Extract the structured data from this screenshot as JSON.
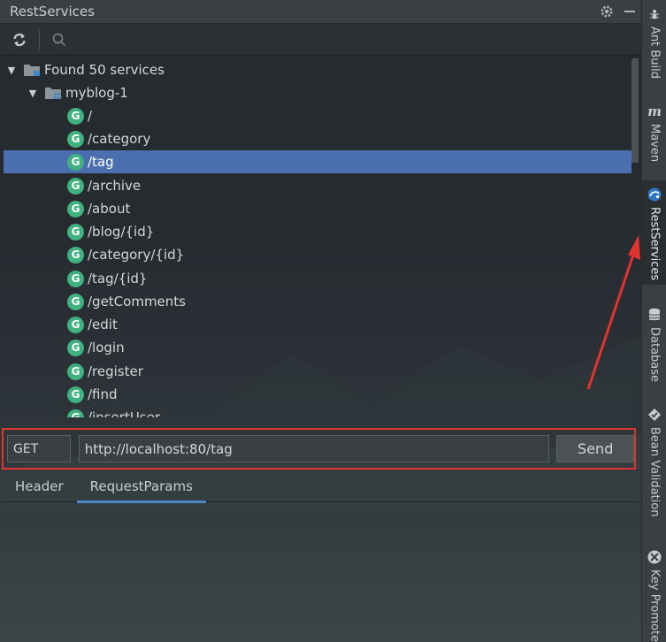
{
  "window": {
    "title": "RestServices"
  },
  "toolbar": {
    "refresh_icon": "refresh-icon",
    "search_icon": "search-icon"
  },
  "tree": {
    "root_label": "Found 50 services",
    "module_label": "myblog-1",
    "method_badge": "G",
    "services": [
      "/",
      "/category",
      "/tag",
      "/archive",
      "/about",
      "/blog/{id}",
      "/category/{id}",
      "/tag/{id}",
      "/getComments",
      "/edit",
      "/login",
      "/register",
      "/find",
      "/insertUser"
    ],
    "selected_service": "/tag"
  },
  "request": {
    "method": "GET",
    "url": "http://localhost:80/tag",
    "send_label": "Send"
  },
  "tabs": [
    {
      "label": "Header",
      "active": false
    },
    {
      "label": "RequestParams",
      "active": true
    }
  ],
  "side_panels": [
    {
      "label": "Ant Build",
      "icon": "ant-icon",
      "active": false
    },
    {
      "label": "Maven",
      "icon": "maven-icon",
      "active": false
    },
    {
      "label": "RestServices",
      "icon": "rest-services-icon",
      "active": true
    },
    {
      "label": "Database",
      "icon": "database-icon",
      "active": false
    },
    {
      "label": "Bean Validation",
      "icon": "bean-validation-icon",
      "active": false
    },
    {
      "label": "Key Promoter",
      "icon": "key-promoter-icon",
      "active": false
    }
  ],
  "colors": {
    "selection": "#4b6eaf",
    "method_badge": "#3fb27f",
    "highlight_annotation": "#e0342f",
    "active_tab_underline": "#4a88c7"
  }
}
